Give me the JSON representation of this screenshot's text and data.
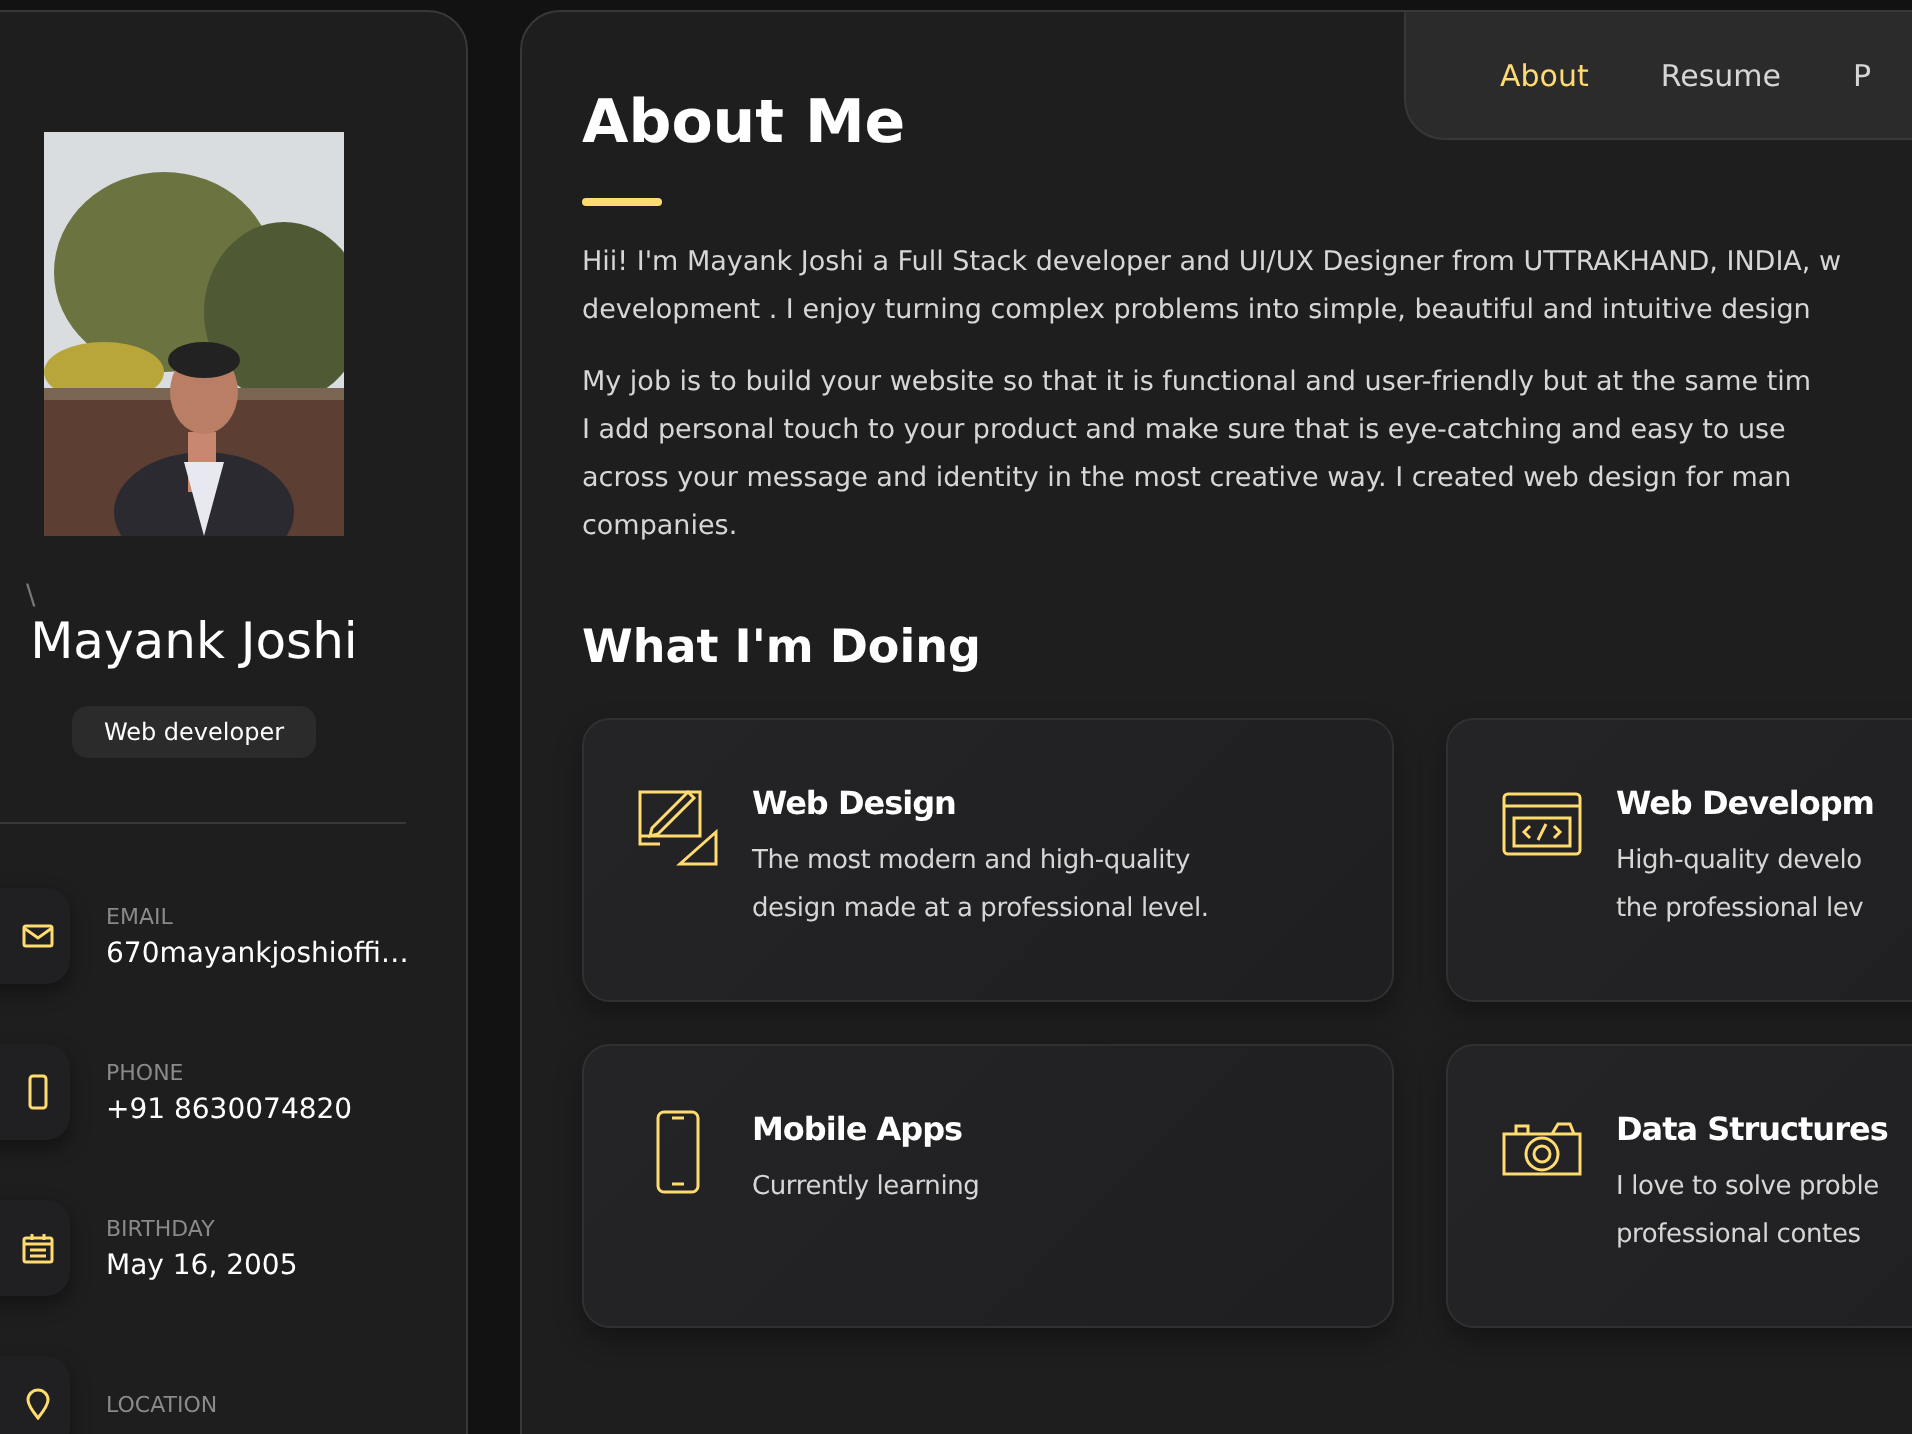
{
  "sidebar": {
    "mark": "\\",
    "name": "Mayank Joshi",
    "title": "Web developer",
    "contacts": [
      {
        "kind": "email",
        "label": "EMAIL",
        "value": "670mayankjoshioffi…"
      },
      {
        "kind": "phone",
        "label": "PHONE",
        "value": "+91 8630074820"
      },
      {
        "kind": "birthday",
        "label": "BIRTHDAY",
        "value": "May 16, 2005"
      },
      {
        "kind": "location",
        "label": "LOCATION"
      }
    ]
  },
  "navbar": [
    {
      "label": "About",
      "selected": true
    },
    {
      "label": "Resume",
      "selected": false
    },
    {
      "label": "P",
      "selected": false
    }
  ],
  "about": {
    "title": "About Me",
    "paragraphs": [
      [
        "Hii! I'm Mayank Joshi a Full Stack developer and UI/UX Designer from UTTRAKHAND, INDIA, w",
        "development . I enjoy turning complex problems into simple, beautiful and intuitive design"
      ],
      [
        "My job is to build your website so that it is functional and user-friendly but at the same tim",
        "I add personal touch to your product and make sure that is eye-catching and easy to use",
        "across your message and identity in the most creative way. I created web design for man",
        "companies."
      ]
    ]
  },
  "services": {
    "title": "What I'm Doing",
    "items": [
      {
        "kind": "design",
        "title": "Web Design",
        "text": [
          "The most modern and high-quality",
          "design made at a professional level."
        ]
      },
      {
        "kind": "code",
        "title": "Web Developm",
        "text": [
          "High-quality develo",
          "the professional lev"
        ]
      },
      {
        "kind": "mobile",
        "title": "Mobile Apps",
        "text": [
          "Currently learning"
        ]
      },
      {
        "kind": "camera",
        "title": "Data Structures",
        "text": [
          "I love to solve proble",
          "professional contes"
        ]
      }
    ]
  }
}
